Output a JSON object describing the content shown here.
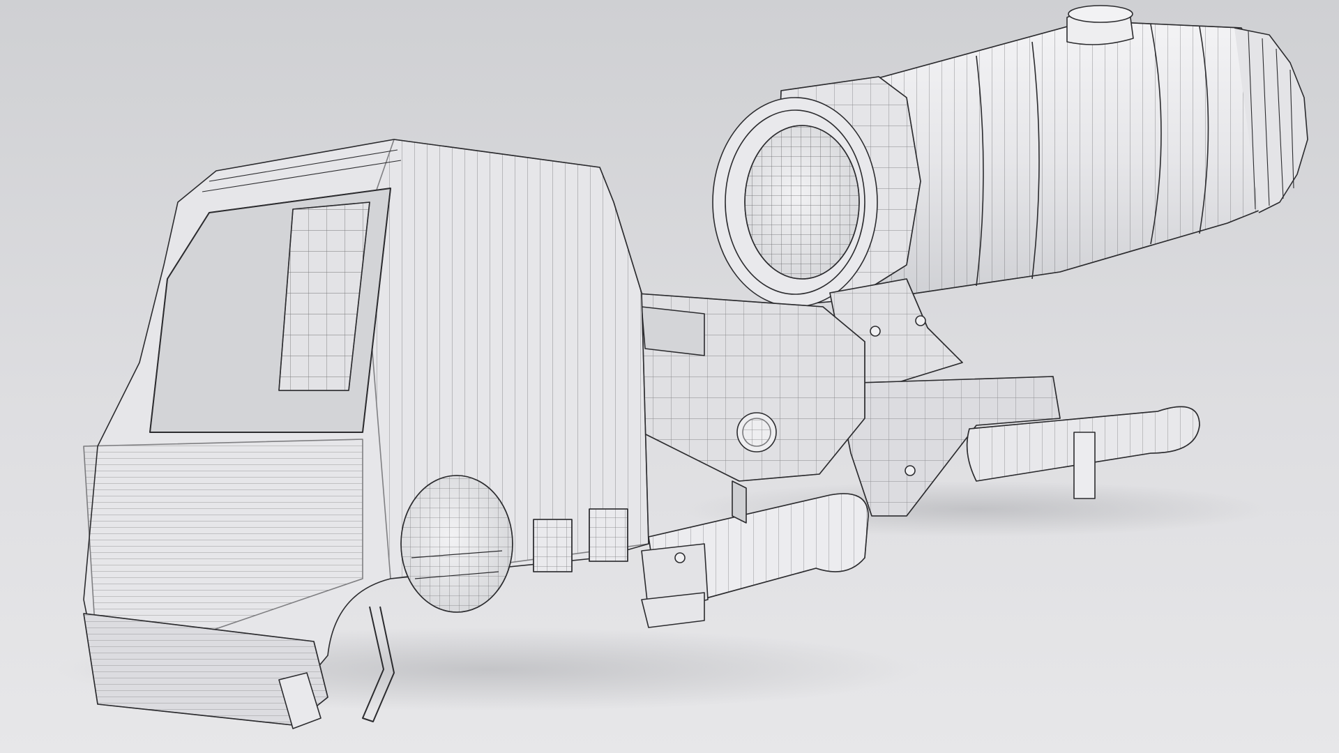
{
  "scene": {
    "kind": "3d-wireframe-render",
    "subject_icon": "holographic-sight-with-magnifier",
    "colors": {
      "background_top": "#cfd0d3",
      "background_bottom": "#e6e6e8",
      "surface_light": "#efeff1",
      "surface_mid": "#e2e2e5",
      "surface_shade": "#d2d3d6",
      "wire": "#2b2b2e",
      "shadow": "#b9babd"
    }
  }
}
